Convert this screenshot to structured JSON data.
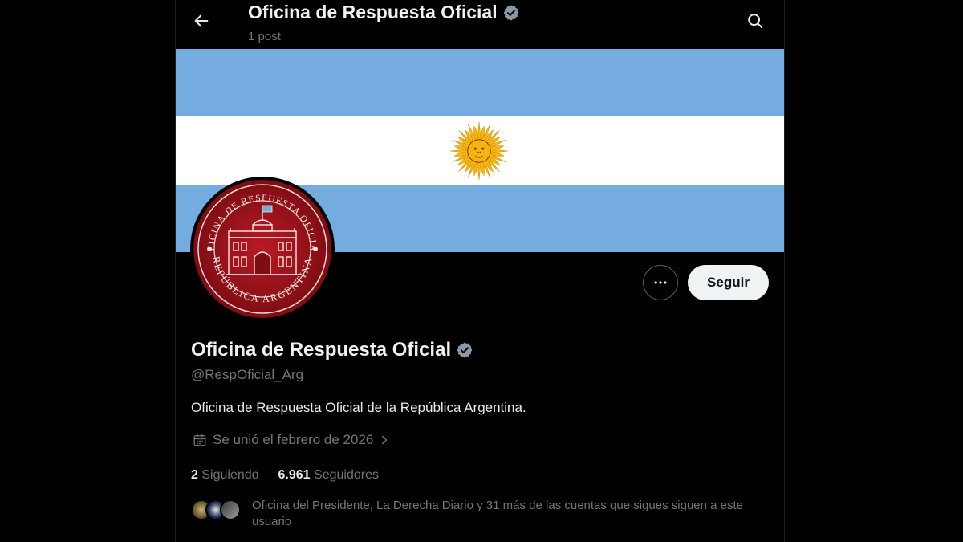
{
  "topbar": {
    "title": "Oficina de Respuesta Oficial",
    "subtitle": "1 post"
  },
  "icons": {
    "back": "arrow-left-icon",
    "search": "search-icon",
    "verified": "verified-badge-icon",
    "more": "more-horizontal-icon",
    "calendar": "calendar-icon",
    "chevron": "chevron-right-icon"
  },
  "avatar": {
    "seal_text_top": "OFICINA DE RESPUESTA OFICIAL",
    "seal_text_bottom": "REPÚBLICA ARGENTINA"
  },
  "actions": {
    "follow_label": "Seguir"
  },
  "profile": {
    "name": "Oficina de Respuesta Oficial",
    "handle": "@RespOficial_Arg",
    "bio": "Oficina de Respuesta Oficial de la República Argentina.",
    "joined": "Se unió el febrero de 2026"
  },
  "stats": {
    "following_count": "2",
    "following_label": "Siguiendo",
    "followers_count": "6.961",
    "followers_label": "Seguidores"
  },
  "followers_you_know": {
    "text": "Oficina del Presidente, La Derecha Diario y 31 más de las cuentas que sigues siguen a este usuario"
  },
  "colors": {
    "background": "#000000",
    "flag_blue": "#74acdf",
    "flag_white": "#ffffff",
    "sun": "#f6b40e",
    "seal_red": "#a3141e",
    "verified": "#8b98a5",
    "text_primary": "#e7e9ea",
    "text_secondary": "#71767b"
  }
}
